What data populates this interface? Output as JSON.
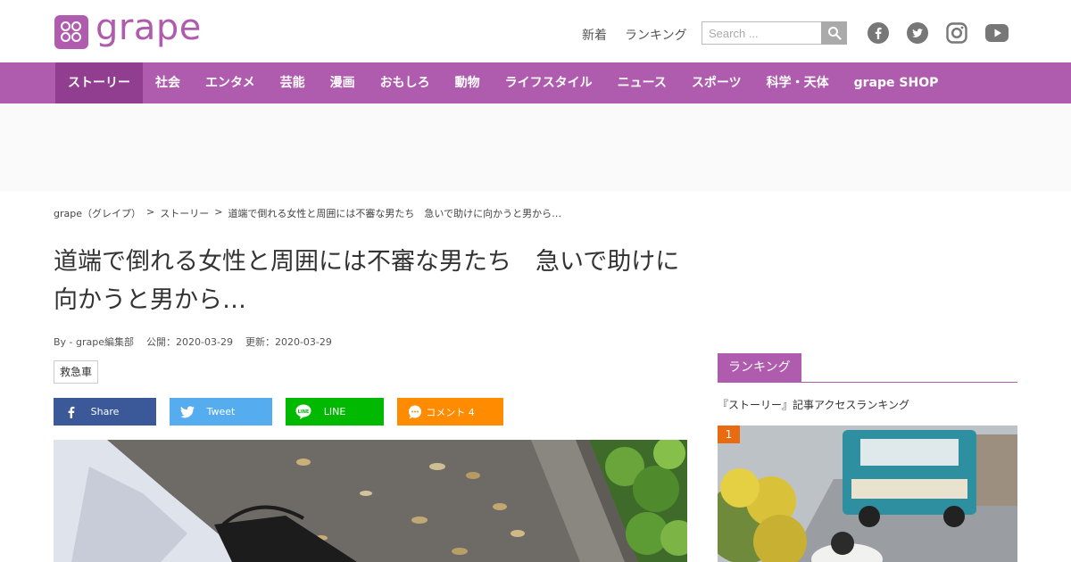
{
  "header": {
    "logo_text": "grape",
    "links": [
      "新着",
      "ランキング"
    ],
    "search_placeholder": "Search ...",
    "social": [
      "facebook-icon",
      "twitter-icon",
      "instagram-icon",
      "youtube-icon"
    ]
  },
  "nav": {
    "items": [
      "ストーリー",
      "社会",
      "エンタメ",
      "芸能",
      "漫画",
      "おもしろ",
      "動物",
      "ライフスタイル",
      "ニュース",
      "スポーツ",
      "科学・天体",
      "grape SHOP"
    ],
    "active_index": 0
  },
  "breadcrumb": [
    "grape（グレイプ）",
    ">",
    "ストーリー",
    ">",
    "道端で倒れる女性と周囲には不審な男たち　急いで助けに向かうと男から…"
  ],
  "article": {
    "title": "道端で倒れる女性と周囲には不審な男たち　急いで助けに向かうと男から…",
    "author": "By - grape編集部",
    "published": "公開：2020-03-29",
    "updated": "更新：2020-03-29",
    "tag": "救急車"
  },
  "share": {
    "facebook": "Share",
    "twitter": "Tweet",
    "line": "LINE",
    "comment": "コメント 4"
  },
  "sidebar": {
    "ranking_title": "ランキング",
    "ranking_subtitle": "『ストーリー』記事アクセスランキング",
    "first_rank": "1"
  },
  "colors": {
    "brand": "#b05cae",
    "brand_dark": "#923e90",
    "facebook": "#3b5998",
    "twitter": "#55acee",
    "line": "#00b900",
    "comment": "#ff8c00",
    "rank_badge": "#e86a11"
  }
}
